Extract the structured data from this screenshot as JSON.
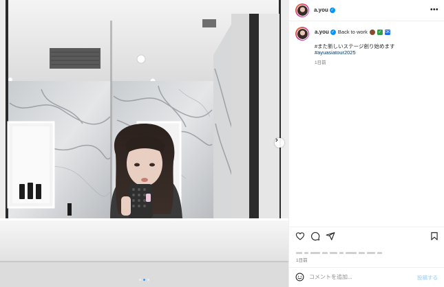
{
  "post": {
    "username": "a.you",
    "verified_badge": "✓",
    "more_icon": "•••",
    "caption_text": "Back to work",
    "caption_emojis": [
      "coffee-icon",
      "check-icon",
      "ok-icon"
    ],
    "ok_glyph": "OK",
    "check_glyph": "✓",
    "caption_line2": "#また新しいステージ創り始めます",
    "hashtag": "#ayuasiatour2025",
    "caption_time": "1日前",
    "post_time": "1日前",
    "comment_placeholder": "コメントを追加...",
    "post_label": "投稿する"
  },
  "carousel": {
    "current_index": 1,
    "total": 3,
    "next_icon": "chevron-right-icon"
  },
  "colors": {
    "link": "#00376b",
    "verified": "#0095f6",
    "post_button": "#b2dffc",
    "meta": "#737373"
  }
}
